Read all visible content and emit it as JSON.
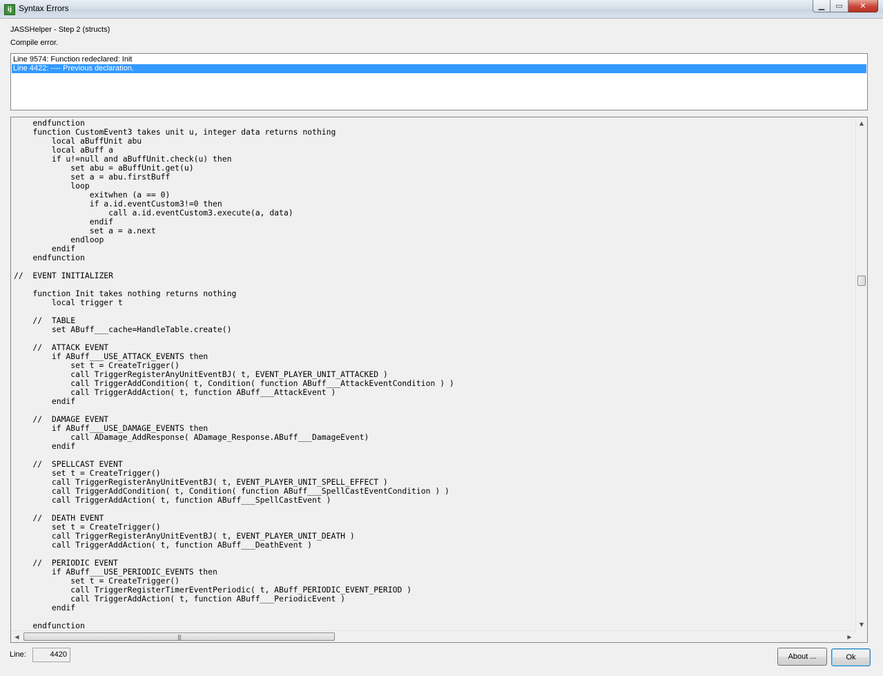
{
  "window": {
    "title": "Syntax Errors",
    "icon_glyph": "ij",
    "caption_min": "▁",
    "caption_max": "▭",
    "caption_close": "✕"
  },
  "header": {
    "step_label": "JASSHelper - Step 2 (structs)",
    "status": "Compile error."
  },
  "errors": [
    "Line 9574: Function redeclared: Init",
    "Line 4422: ---- Previous declaration."
  ],
  "selected_error_index": 1,
  "code_lines": [
    "    endfunction",
    "    function CustomEvent3 takes unit u, integer data returns nothing",
    "        local aBuffUnit abu",
    "        local aBuff a",
    "        if u!=null and aBuffUnit.check(u) then",
    "            set abu = aBuffUnit.get(u)",
    "            set a = abu.firstBuff",
    "            loop",
    "                exitwhen (a == 0)",
    "                if a.id.eventCustom3!=0 then",
    "                    call a.id.eventCustom3.execute(a, data)",
    "                endif",
    "                set a = a.next",
    "            endloop",
    "        endif",
    "    endfunction",
    "",
    "//  EVENT INITIALIZER",
    "",
    "    function Init takes nothing returns nothing",
    "        local trigger t",
    "",
    "    //  TABLE",
    "        set ABuff___cache=HandleTable.create()",
    "",
    "    //  ATTACK EVENT",
    "        if ABuff___USE_ATTACK_EVENTS then",
    "            set t = CreateTrigger()",
    "            call TriggerRegisterAnyUnitEventBJ( t, EVENT_PLAYER_UNIT_ATTACKED )",
    "            call TriggerAddCondition( t, Condition( function ABuff___AttackEventCondition ) )",
    "            call TriggerAddAction( t, function ABuff___AttackEvent )",
    "        endif",
    "",
    "    //  DAMAGE EVENT",
    "        if ABuff___USE_DAMAGE_EVENTS then",
    "            call ADamage_AddResponse( ADamage_Response.ABuff___DamageEvent)",
    "        endif",
    "",
    "    //  SPELLCAST EVENT",
    "        set t = CreateTrigger()",
    "        call TriggerRegisterAnyUnitEventBJ( t, EVENT_PLAYER_UNIT_SPELL_EFFECT )",
    "        call TriggerAddCondition( t, Condition( function ABuff___SpellCastEventCondition ) )",
    "        call TriggerAddAction( t, function ABuff___SpellCastEvent )",
    "",
    "    //  DEATH EVENT",
    "        set t = CreateTrigger()",
    "        call TriggerRegisterAnyUnitEventBJ( t, EVENT_PLAYER_UNIT_DEATH )",
    "        call TriggerAddAction( t, function ABuff___DeathEvent )",
    "",
    "    //  PERIODIC EVENT",
    "        if ABuff___USE_PERIODIC_EVENTS then",
    "            set t = CreateTrigger()",
    "            call TriggerRegisterTimerEventPeriodic( t, ABuff_PERIODIC_EVENT_PERIOD )",
    "            call TriggerAddAction( t, function ABuff___PeriodicEvent )",
    "        endif",
    "",
    "    endfunction"
  ],
  "footer": {
    "line_label": "Line:",
    "line_value": "4420",
    "about_label": "About ...",
    "ok_label": "Ok"
  },
  "colors": {
    "selection": "#3399ff",
    "window_bg": "#f0f0f0"
  }
}
